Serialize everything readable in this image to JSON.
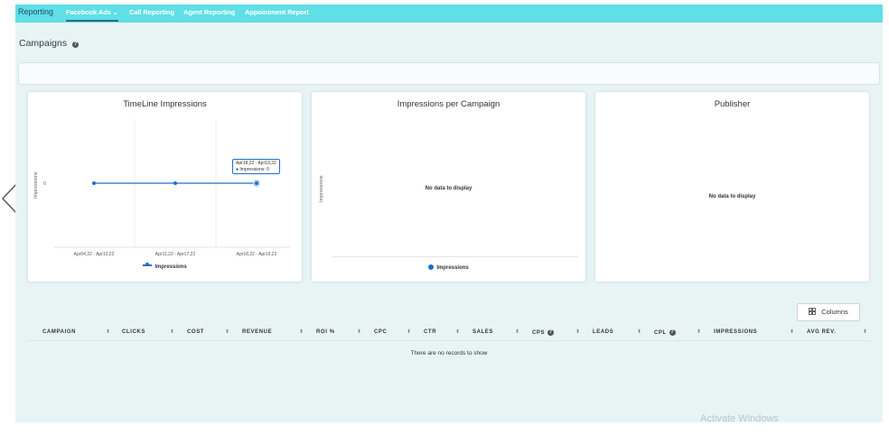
{
  "nav": {
    "brand": "Reporting",
    "items": [
      {
        "label": "Facebook Ads",
        "active": true
      },
      {
        "label": "Call Reporting"
      },
      {
        "label": "Agent Reporting"
      },
      {
        "label": "Appointment Report"
      }
    ]
  },
  "page": {
    "title": "Campaigns"
  },
  "cards": {
    "timeline": {
      "title": "TimeLine Impressions",
      "y_axis_title": "Impressions",
      "legend": "Impressions",
      "tooltip": {
        "range": "Apr18,22 - Apr19,22",
        "value_label": "● Impressions: 0"
      }
    },
    "per_campaign": {
      "title": "Impressions per Campaign",
      "no_data": "No data to display",
      "y_axis_title": "Impressions",
      "legend": "Impressions"
    },
    "publisher": {
      "title": "Publisher",
      "no_data": "No data to display"
    }
  },
  "chart_data": {
    "type": "line",
    "categories": [
      "Apr04,22 - Apr10,22",
      "Apr11,22 - Apr17,22",
      "Apr18,22 - Apr19,22"
    ],
    "series": [
      {
        "name": "Impressions",
        "values": [
          0,
          0,
          0
        ]
      }
    ],
    "y_ticks": [
      "0"
    ],
    "ylabel": "Impressions",
    "legend_position": "bottom",
    "color": "#1e6fc7"
  },
  "table": {
    "columns_button": "Columns",
    "headers": [
      "CAMPAIGN",
      "CLICKS",
      "COST",
      "REVENUE",
      "ROI %",
      "CPC",
      "CTR",
      "SALES",
      "CPS",
      "LEADS",
      "CPL",
      "IMPRESSIONS",
      "AVG REV."
    ],
    "empty_message": "There are no records to show"
  },
  "watermark": "Activate Windows"
}
